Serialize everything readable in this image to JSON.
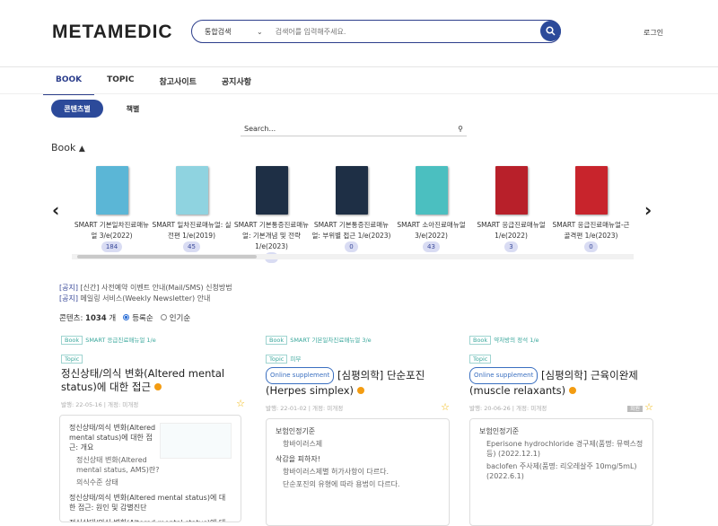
{
  "header": {
    "logo": "METAMEDIC",
    "search_scope": "통합검색",
    "search_placeholder": "검색어를 입력해주세요.",
    "login": "로그인"
  },
  "nav": {
    "tabs": [
      "BOOK",
      "TOPIC",
      "참고사이트",
      "공지사항"
    ]
  },
  "view_toggle": {
    "by_content": "콘텐츠별",
    "by_book": "책별"
  },
  "book_search": {
    "placeholder": "Search..."
  },
  "book_section": {
    "label": "Book",
    "arrow": "▲"
  },
  "books": [
    {
      "title": "SMART 기본일차진료매뉴얼 3/e(2022)",
      "count": "184",
      "color": "#5bb6d6"
    },
    {
      "title": "SMART 일차진료매뉴얼: 실전편 1/e(2019)",
      "count": "45",
      "color": "#8fd3e0"
    },
    {
      "title": "SMART 기본통증진료매뉴얼: 기본개념 및 전략 1/e(2023)",
      "count": "0",
      "color": "#1e2f45"
    },
    {
      "title": "SMART 기본통증진료매뉴얼: 부위별 접근 1/e(2023)",
      "count": "0",
      "color": "#1e2f45"
    },
    {
      "title": "SMART 소아진료매뉴얼 3/e(2022)",
      "count": "43",
      "color": "#4bbfc0"
    },
    {
      "title": "SMART 응급진료매뉴얼 1/e(2022)",
      "count": "3",
      "color": "#b8202a"
    },
    {
      "title": "SMART 응급진료매뉴얼-근골격편 1/e(2023)",
      "count": "0",
      "color": "#c8242c"
    }
  ],
  "notices": [
    {
      "tag": "[공지]",
      "text": "[신간] 사전예약 이벤트 안내(Mail/SMS) 신청방법"
    },
    {
      "tag": "[공지]",
      "text": "메일링 서비스(Weekly Newsletter) 안내"
    }
  ],
  "content_count": {
    "label": "콘텐츠:",
    "value": "1034",
    "unit": "개",
    "sort_options": [
      "등록순",
      "인기순"
    ]
  },
  "cards": [
    {
      "book_tag": "Book",
      "book": "SMART 응급진료매뉴얼 1/e",
      "topic_tag": "Topic",
      "topic": "",
      "online": "",
      "title": "정신상태/의식 변화(Altered mental status)에 대한 접근",
      "meta": "발행: 22-05-16 | 개정: 미개정",
      "member": "",
      "toc": [
        {
          "h": "정신상태/의식 변화(Altered mental status)에 대한 접근: 개요",
          "items": [
            "정신상태 변화(Altered mental status, AMS)란?",
            "의식수준 상태"
          ]
        },
        {
          "h": "정신상태/의식 변화(Altered mental status)에 대한 접근: 원인 및 감별진단",
          "items": []
        },
        {
          "h": "정신상태/의식 변화(Altered mental status)에 대한 접근:",
          "items": []
        }
      ]
    },
    {
      "book_tag": "Book",
      "book": "SMART 기본일차진료매뉴얼 3/e",
      "topic_tag": "Topic",
      "topic": "피부",
      "online": "Online supplement",
      "title": "[심평의학] 단순포진(Herpes simplex)",
      "meta": "발행: 22-01-02 | 개정: 미개정",
      "member": "",
      "toc": [
        {
          "h": "보험인정기준",
          "items": [
            "항바이러스제"
          ]
        },
        {
          "h": "삭감을 피하자!",
          "items": [
            "항바이러스제별 허가사항이 다르다.",
            "단순포진의 유형에 따라 용법이 다르다."
          ]
        }
      ]
    },
    {
      "book_tag": "Book",
      "book": "약처방의 정석 1/e",
      "topic_tag": "Topic",
      "topic": "",
      "online": "Online supplement",
      "title": "[심평의학] 근육이완제(muscle relaxants)",
      "meta": "발행: 20-06-26 | 개정: 미개정",
      "member": "회원",
      "toc": [
        {
          "h": "보험인정기준",
          "items": [
            "Eperisone hydrochloride 경구제(품명: 뮤렉스정 등) (2022.12.1)",
            "baclofen 주사제(품명: 리오레살주 10mg/5mL) (2022.6.1)"
          ]
        }
      ]
    }
  ]
}
